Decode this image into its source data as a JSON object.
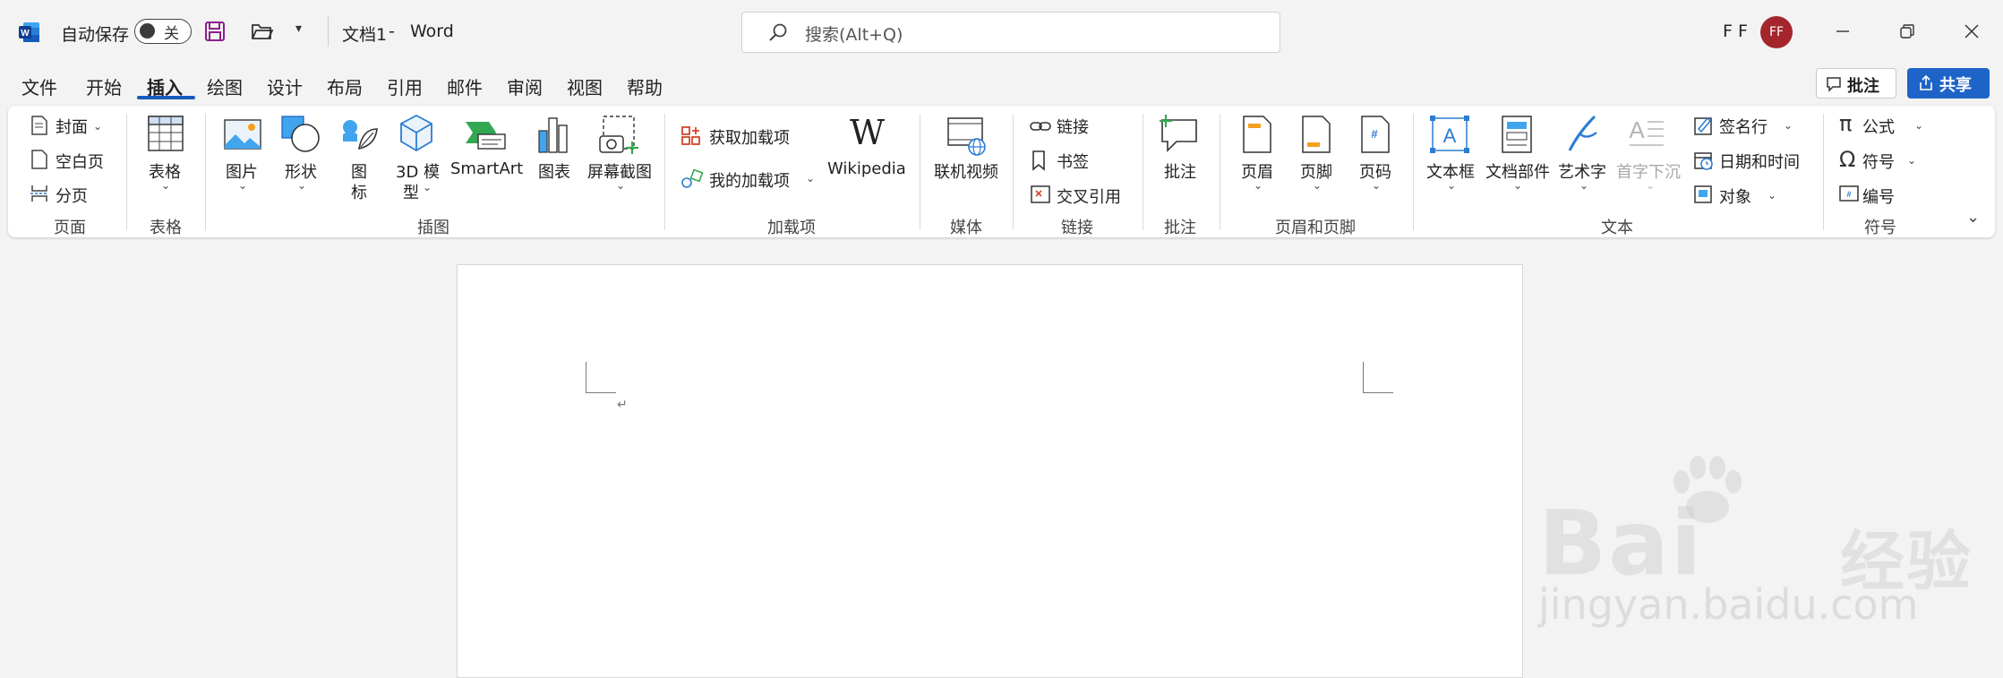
{
  "titlebar": {
    "autosave_label": "自动保存",
    "autosave_state": "关",
    "doc_title": "文档1",
    "separator": "-",
    "app_name": "Word",
    "search_placeholder": "搜索(Alt+Q)",
    "user_name": "F F",
    "avatar_initials": "FF"
  },
  "menu": {
    "tabs": [
      "文件",
      "开始",
      "插入",
      "绘图",
      "设计",
      "布局",
      "引用",
      "邮件",
      "审阅",
      "视图",
      "帮助"
    ],
    "active_tab": "插入",
    "comment_button": "批注",
    "share_button": "共享"
  },
  "ribbon": {
    "pages": {
      "cover": "封面",
      "blank": "空白页",
      "break": "分页",
      "group": "页面"
    },
    "tables": {
      "table": "表格",
      "group": "表格"
    },
    "illustrations": {
      "picture": "图片",
      "shapes": "形状",
      "icons_1": "图",
      "icons_2": "标",
      "model3d_1": "3D 模",
      "model3d_2": "型",
      "smartart": "SmartArt",
      "chart": "图表",
      "screenshot": "屏幕截图",
      "group": "插图"
    },
    "addins": {
      "get": "获取加载项",
      "my": "我的加载项",
      "wikipedia": "Wikipedia",
      "group": "加载项"
    },
    "media": {
      "video": "联机视频",
      "group": "媒体"
    },
    "links": {
      "link": "链接",
      "bookmark": "书签",
      "crossref": "交叉引用",
      "group": "链接"
    },
    "comments": {
      "comment": "批注",
      "group": "批注"
    },
    "header_footer": {
      "header": "页眉",
      "footer": "页脚",
      "page_number": "页码",
      "group": "页眉和页脚"
    },
    "text": {
      "textbox": "文本框",
      "quickparts": "文档部件",
      "wordart": "艺术字",
      "dropcap": "首字下沉",
      "signature": "签名行",
      "datetime": "日期和时间",
      "object": "对象",
      "group": "文本"
    },
    "symbols": {
      "equation": "公式",
      "symbol": "符号",
      "number": "编号",
      "group": "符号"
    }
  },
  "watermark": {
    "brand": "Bai",
    "brand_cn": "经验",
    "url": "jingyan.baidu.com"
  },
  "colors": {
    "accent": "#185abd",
    "share_bg": "#1e64c8",
    "avatar_bg": "#a4262c"
  }
}
